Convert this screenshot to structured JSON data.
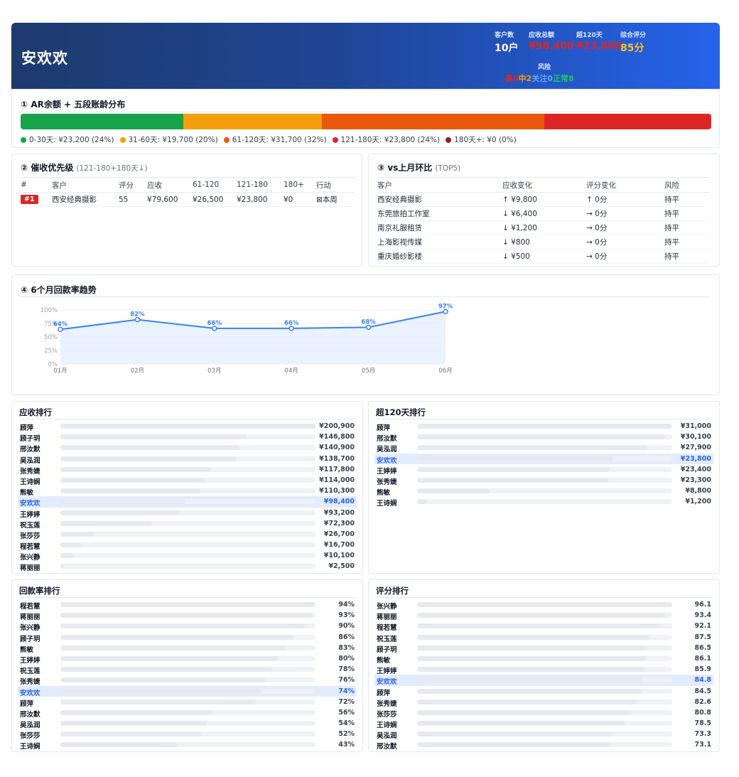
{
  "header": {
    "title": "安欢欢",
    "stats": [
      {
        "label": "客户数",
        "value": "10户",
        "color": "#ffffff"
      },
      {
        "label": "应收总额",
        "value": "¥98,400",
        "color": "#dc2626"
      },
      {
        "label": "超120天",
        "value": "¥23,800",
        "color": "#dc2626"
      },
      {
        "label": "综合评分",
        "value": "85分",
        "color": "#fbbf24"
      }
    ],
    "risk_label": "风险",
    "risk_parts": [
      {
        "text": "高0",
        "color": "#dc2626"
      },
      {
        "text": "中2",
        "color": "#f59e0b"
      },
      {
        "text": "关注0",
        "color": "#60a5fa"
      },
      {
        "text": "正常8",
        "color": "#22c55e"
      }
    ]
  },
  "aging": {
    "title": "① AR余额 + 五段账龄分布",
    "segments": [
      {
        "label": "0-30天: ¥23,200 (24%)",
        "share": 23.6,
        "color": "#16a34a"
      },
      {
        "label": "31-60天: ¥19,700 (20%)",
        "share": 20.0,
        "color": "#f59e0b"
      },
      {
        "label": "61-120天: ¥31,700 (32%)",
        "share": 32.2,
        "color": "#ea580c"
      },
      {
        "label": "121-180天: ¥23,800 (24%)",
        "share": 24.2,
        "color": "#dc2626"
      },
      {
        "label": "180天+: ¥0 (0%)",
        "share": 0,
        "color": "#991b1b"
      }
    ]
  },
  "priority": {
    "title": "② 催收优先级",
    "subtitle": "(121-180+180天↓)",
    "headers": [
      "#",
      "客户",
      "评分",
      "应收",
      "61-120",
      "121-180",
      "180+",
      "行动"
    ],
    "rows": [
      {
        "rank": "#1",
        "customer": "西安经典摄影",
        "score": "55",
        "ar": "¥79,600",
        "d61": "¥26,500",
        "d121": "¥23,800",
        "d180": "¥0",
        "action": "本周"
      }
    ]
  },
  "mom": {
    "title": "③ vs上月环比",
    "subtitle": "(TOP5)",
    "headers": [
      "客户",
      "应收变化",
      "评分变化",
      "风险"
    ],
    "rows": [
      {
        "customer": "西安经典摄影",
        "ar_change": "↑ ¥9,800",
        "ar_dir": "up",
        "score_change": "↑ 0分",
        "score_dir": "up",
        "risk": "持平"
      },
      {
        "customer": "东莞旅拍工作室",
        "ar_change": "↓ ¥6,400",
        "ar_dir": "down",
        "score_change": "→ 0分",
        "score_dir": "flat",
        "risk": "持平"
      },
      {
        "customer": "南京礼服租赁",
        "ar_change": "↓ ¥1,200",
        "ar_dir": "down",
        "score_change": "→ 0分",
        "score_dir": "flat",
        "risk": "持平"
      },
      {
        "customer": "上海影视传媒",
        "ar_change": "↓ ¥800",
        "ar_dir": "down",
        "score_change": "→ 0分",
        "score_dir": "flat",
        "risk": "持平"
      },
      {
        "customer": "重庆婚纱影楼",
        "ar_change": "↓ ¥500",
        "ar_dir": "down",
        "score_change": "→ 0分",
        "score_dir": "flat",
        "risk": "持平"
      }
    ]
  },
  "chart_data": {
    "type": "area",
    "title": "④ 6个月回款率趋势",
    "categories": [
      "01月",
      "02月",
      "03月",
      "04月",
      "05月",
      "06月"
    ],
    "values": [
      64,
      82,
      66,
      66,
      68,
      97
    ],
    "value_labels": [
      "64%",
      "82%",
      "66%",
      "66%",
      "68%",
      "97%"
    ],
    "y_ticks": [
      "0%",
      "25%",
      "50%",
      "75%",
      "100%"
    ],
    "ylim": [
      0,
      100
    ],
    "line_color": "#3b82f6",
    "grid": true
  },
  "rankings": {
    "ar": {
      "title": "应收排行",
      "highlight": "安欢欢",
      "items": [
        {
          "name": "顾萍",
          "value": 200900,
          "label": "¥200,900"
        },
        {
          "name": "顾子玥",
          "value": 146800,
          "label": "¥146,800"
        },
        {
          "name": "邢汝默",
          "value": 140900,
          "label": "¥140,900"
        },
        {
          "name": "吴泓润",
          "value": 138700,
          "label": "¥138,700"
        },
        {
          "name": "张秀婕",
          "value": 117800,
          "label": "¥117,800"
        },
        {
          "name": "王诗娴",
          "value": 114000,
          "label": "¥114,000"
        },
        {
          "name": "熊敏",
          "value": 110300,
          "label": "¥110,300"
        },
        {
          "name": "安欢欢",
          "value": 98400,
          "label": "¥98,400"
        },
        {
          "name": "王婷婷",
          "value": 93200,
          "label": "¥93,200"
        },
        {
          "name": "祝玉莲",
          "value": 72300,
          "label": "¥72,300"
        },
        {
          "name": "张莎莎",
          "value": 26700,
          "label": "¥26,700"
        },
        {
          "name": "程若慧",
          "value": 16700,
          "label": "¥16,700"
        },
        {
          "name": "张兴静",
          "value": 10100,
          "label": "¥10,100"
        },
        {
          "name": "蒋丽丽",
          "value": 2500,
          "label": "¥2,500"
        }
      ]
    },
    "over120": {
      "title": "超120天排行",
      "highlight": "安欢欢",
      "items": [
        {
          "name": "顾萍",
          "value": 31000,
          "label": "¥31,000"
        },
        {
          "name": "邢汝默",
          "value": 30100,
          "label": "¥30,100"
        },
        {
          "name": "吴泓润",
          "value": 27900,
          "label": "¥27,900"
        },
        {
          "name": "安欢欢",
          "value": 23800,
          "label": "¥23,800"
        },
        {
          "name": "王婷婷",
          "value": 23400,
          "label": "¥23,400"
        },
        {
          "name": "张秀婕",
          "value": 23300,
          "label": "¥23,300"
        },
        {
          "name": "熊敏",
          "value": 8800,
          "label": "¥8,800"
        },
        {
          "name": "王诗娴",
          "value": 1200,
          "label": "¥1,200"
        }
      ]
    },
    "collection": {
      "title": "回款率排行",
      "highlight": "安欢欢",
      "items": [
        {
          "name": "程若慧",
          "value": 94,
          "label": "94%"
        },
        {
          "name": "蒋丽丽",
          "value": 93,
          "label": "93%"
        },
        {
          "name": "张兴静",
          "value": 90,
          "label": "90%"
        },
        {
          "name": "顾子玥",
          "value": 86,
          "label": "86%"
        },
        {
          "name": "熊敏",
          "value": 83,
          "label": "83%"
        },
        {
          "name": "王婷婷",
          "value": 80,
          "label": "80%"
        },
        {
          "name": "祝玉莲",
          "value": 78,
          "label": "78%"
        },
        {
          "name": "张秀婕",
          "value": 76,
          "label": "76%"
        },
        {
          "name": "安欢欢",
          "value": 74,
          "label": "74%"
        },
        {
          "name": "顾萍",
          "value": 72,
          "label": "72%"
        },
        {
          "name": "邢汝默",
          "value": 56,
          "label": "56%"
        },
        {
          "name": "吴泓润",
          "value": 54,
          "label": "54%"
        },
        {
          "name": "张莎莎",
          "value": 52,
          "label": "52%"
        },
        {
          "name": "王诗娴",
          "value": 43,
          "label": "43%"
        }
      ]
    },
    "score": {
      "title": "评分排行",
      "highlight": "安欢欢",
      "items": [
        {
          "name": "张兴静",
          "value": 96.1,
          "label": "96.1"
        },
        {
          "name": "蒋丽丽",
          "value": 93.4,
          "label": "93.4"
        },
        {
          "name": "程若慧",
          "value": 92.1,
          "label": "92.1"
        },
        {
          "name": "祝玉莲",
          "value": 87.5,
          "label": "87.5"
        },
        {
          "name": "顾子玥",
          "value": 86.5,
          "label": "86.5"
        },
        {
          "name": "熊敏",
          "value": 86.1,
          "label": "86.1"
        },
        {
          "name": "王婷婷",
          "value": 85.9,
          "label": "85.9"
        },
        {
          "name": "安欢欢",
          "value": 84.8,
          "label": "84.8"
        },
        {
          "name": "顾萍",
          "value": 84.5,
          "label": "84.5"
        },
        {
          "name": "张秀婕",
          "value": 82.6,
          "label": "82.6"
        },
        {
          "name": "张莎莎",
          "value": 80.8,
          "label": "80.8"
        },
        {
          "name": "王诗娴",
          "value": 78.5,
          "label": "78.5"
        },
        {
          "name": "吴泓润",
          "value": 73.3,
          "label": "73.3"
        },
        {
          "name": "邢汝默",
          "value": 73.1,
          "label": "73.1"
        }
      ]
    }
  }
}
